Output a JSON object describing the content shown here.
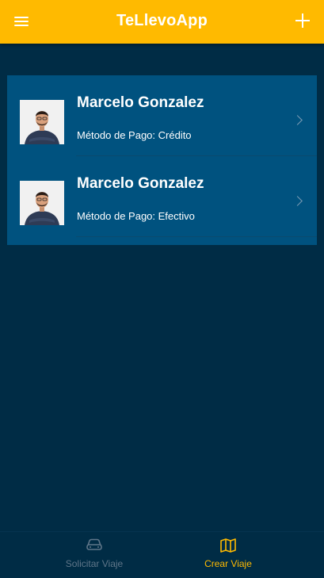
{
  "header": {
    "title": "TeLlevoApp",
    "menu_icon": "hamburger-menu-icon",
    "add_icon": "plus-icon",
    "background_color": "#ffba00"
  },
  "trips": [
    {
      "name": "Marcelo Gonzalez",
      "payment": "Método de Pago: Crédito",
      "avatar_icon": "person-avatar",
      "chevron_icon": "chevron-right-icon"
    },
    {
      "name": "Marcelo Gonzalez",
      "payment": "Método de Pago: Efectivo",
      "avatar_icon": "person-avatar",
      "chevron_icon": "chevron-right-icon"
    }
  ],
  "tabs": [
    {
      "label": "Solicitar Viaje",
      "icon": "car-icon",
      "active": false
    },
    {
      "label": "Crear Viaje",
      "icon": "map-icon",
      "active": true
    }
  ],
  "colors": {
    "background": "#002c45",
    "list_background": "#00527f",
    "accent": "#ffba00",
    "inactive_tab": "#5f7689"
  }
}
